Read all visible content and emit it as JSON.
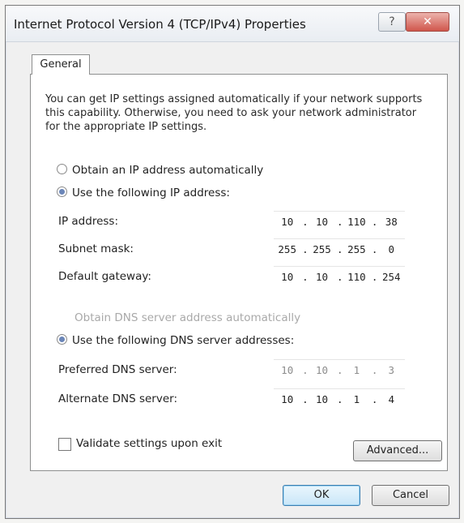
{
  "window": {
    "title": "Internet Protocol Version 4 (TCP/IPv4) Properties",
    "help_label": "?",
    "close_label": "✕"
  },
  "tabs": [
    {
      "label": "General",
      "selected": true
    }
  ],
  "general": {
    "description": "You can get IP settings assigned automatically if your network supports this capability. Otherwise, you need to ask your network administrator for the appropriate IP settings.",
    "ip_mode": {
      "auto_label": "Obtain an IP address automatically",
      "manual_label": "Use the following IP address:",
      "selected": "manual"
    },
    "ip_fields": [
      {
        "label": "IP address:",
        "octets": [
          "10",
          "10",
          "110",
          "38"
        ]
      },
      {
        "label": "Subnet mask:",
        "octets": [
          "255",
          "255",
          "255",
          "0"
        ]
      },
      {
        "label": "Default gateway:",
        "octets": [
          "10",
          "10",
          "110",
          "254"
        ]
      }
    ],
    "dns_mode": {
      "auto_label": "Obtain DNS server address automatically",
      "manual_label": "Use the following DNS server addresses:",
      "selected": "manual"
    },
    "dns_fields": [
      {
        "label": "Preferred DNS server:",
        "octets": [
          "10",
          "10",
          "1",
          "3"
        ]
      },
      {
        "label": "Alternate DNS server:",
        "octets": [
          "10",
          "10",
          "1",
          "4"
        ]
      }
    ],
    "validate": {
      "label": "Validate settings upon exit",
      "checked": false
    },
    "advanced_label": "Advanced..."
  },
  "footer": {
    "ok_label": "OK",
    "cancel_label": "Cancel"
  }
}
